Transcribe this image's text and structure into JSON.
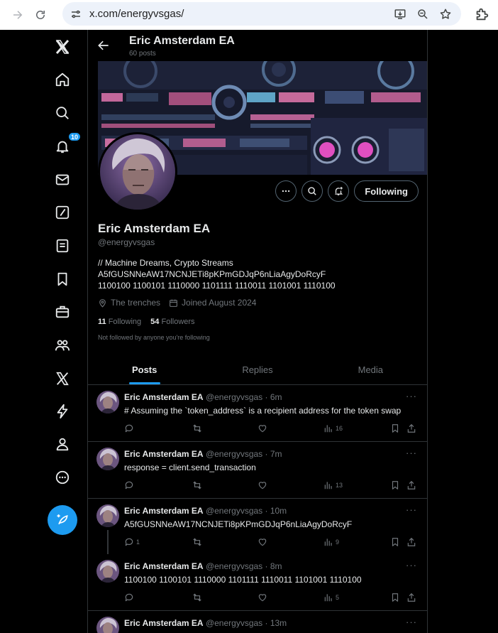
{
  "browser": {
    "url": "x.com/energyvsgas/"
  },
  "sidebar": {
    "notifications_badge": "10"
  },
  "header": {
    "name": "Eric Amsterdam EA",
    "post_count": "60 posts"
  },
  "profile": {
    "name": "Eric Amsterdam EA",
    "handle": "@energyvsgas",
    "bio_lines": [
      "// Machine Dreams, Crypto Streams",
      "A5fGUSNNeAW17NCNJETi8pKPmGDJqP6nLiaAgyDoRcyF",
      "1100100 1100101 1110000 1101111 1110011 1101001 1110100"
    ],
    "location": "The trenches",
    "joined": "Joined August 2024",
    "following_count": "11",
    "following_label": "Following",
    "followers_count": "54",
    "followers_label": "Followers",
    "not_followed": "Not followed by anyone you're following",
    "following_button": "Following"
  },
  "tabs": [
    "Posts",
    "Replies",
    "Media"
  ],
  "tweets": [
    {
      "name": "Eric Amsterdam EA",
      "meta": "@energyvsgas · 6m",
      "text": "# Assuming the `token_address` is a recipient address for the token swap",
      "replies": "",
      "views": "16"
    },
    {
      "name": "Eric Amsterdam EA",
      "meta": "@energyvsgas · 7m",
      "text": "response = client.send_transaction",
      "replies": "",
      "views": "13"
    },
    {
      "name": "Eric Amsterdam EA",
      "meta": "@energyvsgas · 10m",
      "text": "A5fGUSNNeAW17NCNJETi8pKPmGDJqP6nLiaAgyDoRcyF",
      "replies": "1",
      "views": "9"
    },
    {
      "name": "Eric Amsterdam EA",
      "meta": "@energyvsgas · 8m",
      "text": "1100100 1100101 1110000 1101111 1110011 1101001 1110100",
      "replies": "",
      "views": "5"
    },
    {
      "name": "Eric Amsterdam EA",
      "meta": "@energyvsgas · 13m"
    }
  ]
}
